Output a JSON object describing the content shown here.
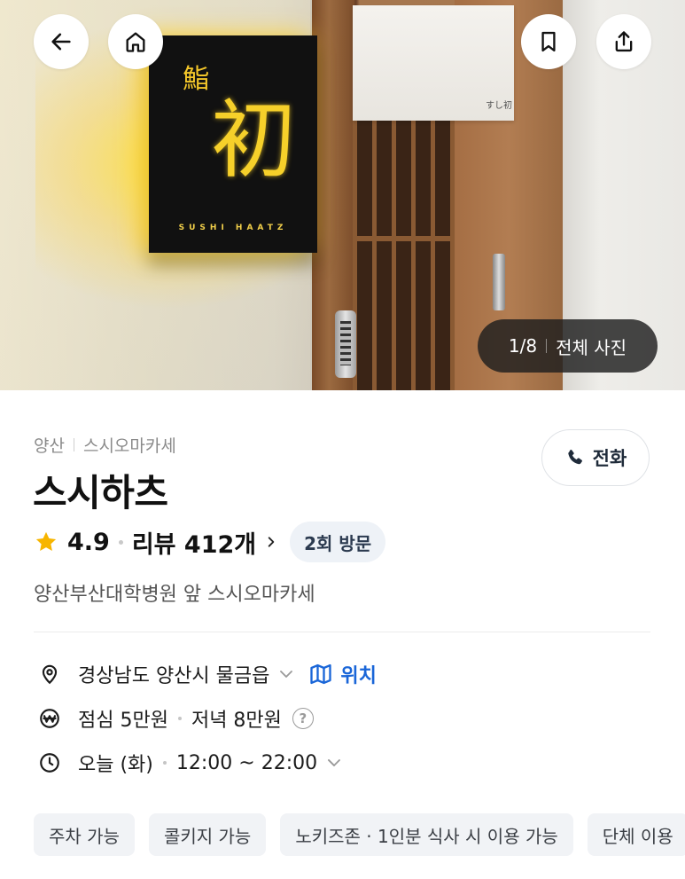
{
  "header": {
    "back_icon": "arrow-left-icon",
    "home_icon": "home-icon",
    "bookmark_icon": "bookmark-icon",
    "share_icon": "share-icon"
  },
  "photo": {
    "sign_small_char": "鮨",
    "sign_big_char": "初",
    "sign_english": "SUSHI HAATZ",
    "curtain_mark": "すし初",
    "counter": "1/8",
    "all_photos_label": "전체 사진"
  },
  "place": {
    "region": "양산",
    "category": "스시오마카세",
    "name": "스시하츠",
    "call_label": "전화",
    "rating": "4.9",
    "reviews_label": "리뷰 412개",
    "visit_badge": "2회 방문",
    "description": "양산부산대학병원 앞 스시오마카세",
    "address": "경상남도 양산시 물금읍",
    "location_label": "위치",
    "lunch_price": "점심 5만원",
    "dinner_price": "저녁 8만원",
    "help_icon_text": "?",
    "hours_day": "오늘 (화)",
    "hours_time": "12:00 ~ 22:00",
    "tags": [
      "주차 가능",
      "콜키지 가능",
      "노키즈존 · 1인분 식사 시 이용 가능",
      "단체 이용"
    ]
  },
  "colors": {
    "accent_link": "#1a66d8",
    "star": "#f7b500",
    "badge_bg": "#eef2f7",
    "tag_bg": "#f1f3f6",
    "counter_bg": "#1e1e1e"
  }
}
